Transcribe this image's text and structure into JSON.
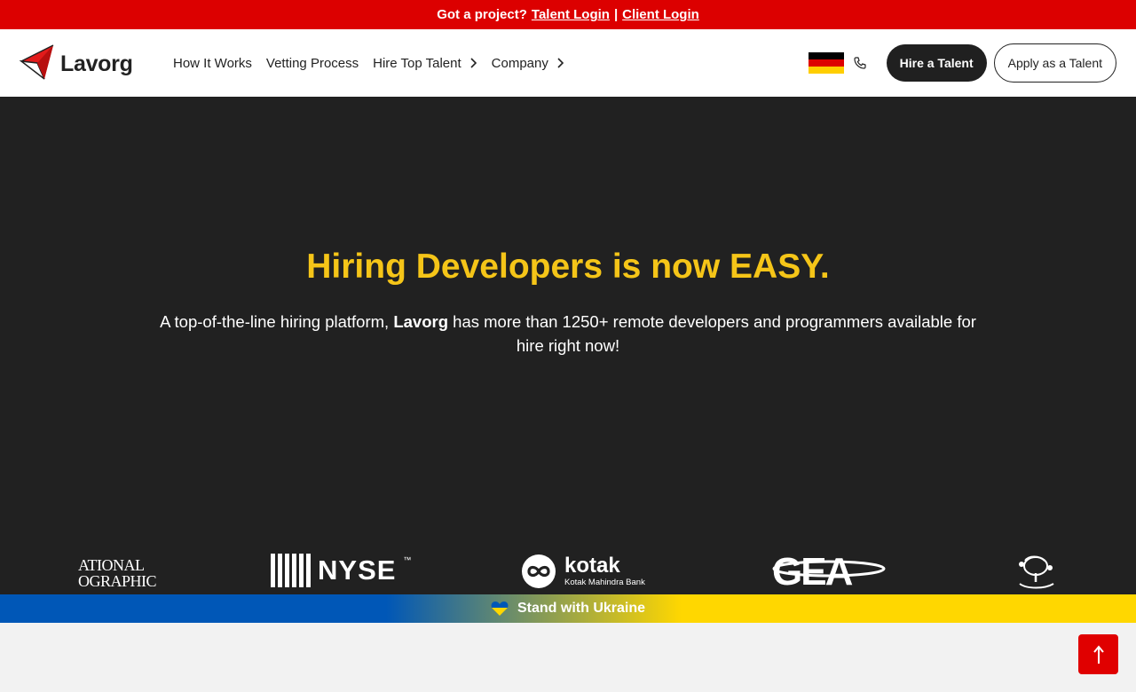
{
  "topbar": {
    "prompt": "Got a project?",
    "talent_login": "Talent Login",
    "separator": "|",
    "client_login": "Client Login",
    "bg_color": "#dc0000"
  },
  "header": {
    "logo_text": "Lavorg",
    "nav": [
      {
        "label": "How It Works"
      },
      {
        "label": "Vetting Process"
      },
      {
        "label": "Hire Top Talent"
      },
      {
        "label": "Company"
      }
    ],
    "language_flag_icon": "germany-flag-icon",
    "hire_button": "Hire a Talent",
    "apply_button": "Apply as a Talent"
  },
  "hero": {
    "title": "Hiring Developers is now EASY.",
    "subtitle_pre": "A top-of-the-line hiring platform,",
    "subtitle_brand": "Lavorg",
    "subtitle_post": "has more than 1250+ remote developers and programmers available for hire right now!",
    "title_color": "#f5c518",
    "bg_color": "#212121"
  },
  "client_logos": {
    "natgeo_line1": "ATIONAL",
    "natgeo_line2": "OGRAPHIC",
    "nyse": "NYSE",
    "nyse_tm": "™",
    "kotak": "kotak",
    "kotak_sub": "Kotak Mahindra Bank",
    "gea": "GEA"
  },
  "ukraine_banner": {
    "text": "Stand with Ukraine",
    "blue": "#0057b7",
    "yellow": "#ffd700"
  },
  "scroll_top": {
    "icon": "arrow-up-icon"
  }
}
